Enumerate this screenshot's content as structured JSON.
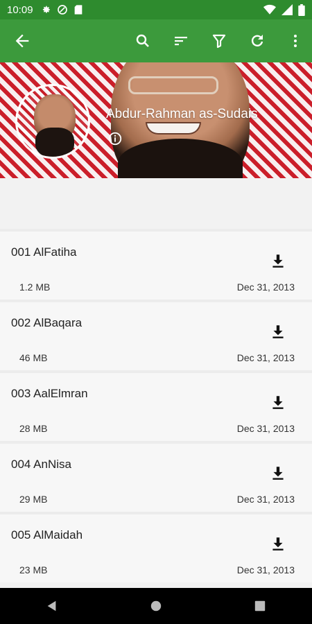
{
  "status": {
    "time": "10:09",
    "left_icons": [
      "settings-icon",
      "vpn-icon",
      "sd-card-icon"
    ],
    "right_icons": [
      "wifi-icon",
      "signal-icon",
      "battery-icon"
    ]
  },
  "appbar": {
    "actions": [
      "search-icon",
      "sort-icon",
      "filter-icon",
      "refresh-icon",
      "more-icon"
    ],
    "color": "#3c9a3c"
  },
  "header": {
    "reciter_name": "Abdur-Rahman as-Sudais"
  },
  "tracks": [
    {
      "title": "001 AlFatiha",
      "size": "1.2 MB",
      "date": "Dec 31, 2013"
    },
    {
      "title": "002 AlBaqara",
      "size": "46 MB",
      "date": "Dec 31, 2013"
    },
    {
      "title": "003 AalElmran",
      "size": "28 MB",
      "date": "Dec 31, 2013"
    },
    {
      "title": "004 AnNisa",
      "size": "29 MB",
      "date": "Dec 31, 2013"
    },
    {
      "title": "005 AlMaidah",
      "size": "23 MB",
      "date": "Dec 31, 2013"
    }
  ]
}
